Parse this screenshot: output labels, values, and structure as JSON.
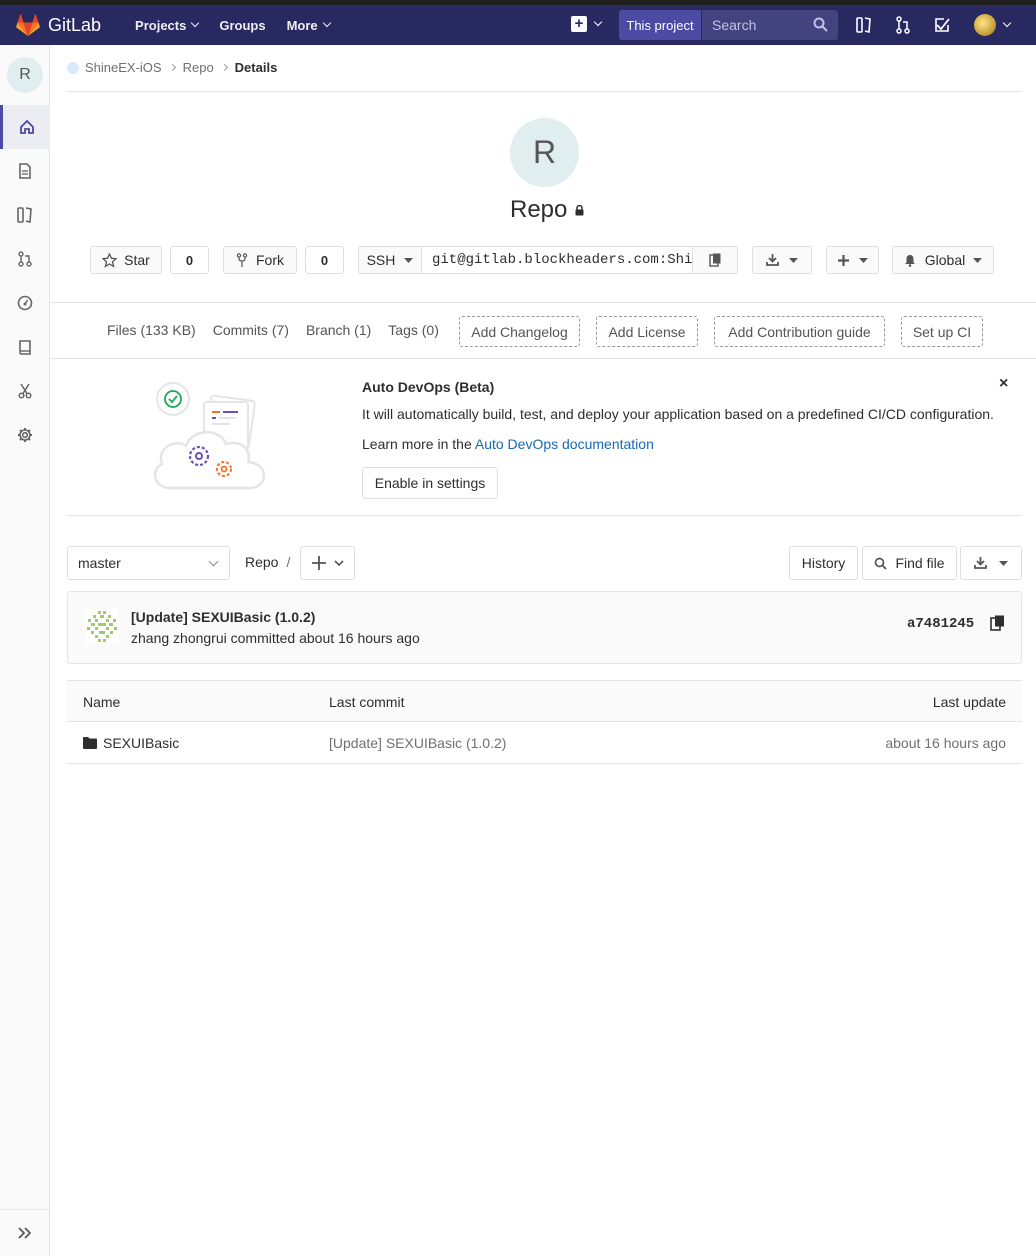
{
  "navbar": {
    "brand": "GitLab",
    "links": [
      "Projects",
      "Groups",
      "More"
    ],
    "this_project": "This project",
    "search_placeholder": "Search"
  },
  "sidebar": {
    "avatar_letter": "R"
  },
  "breadcrumb": {
    "group": "ShineEX-iOS",
    "project": "Repo",
    "current": "Details"
  },
  "project": {
    "avatar_letter": "R",
    "name": "Repo",
    "star_label": "Star",
    "star_count": "0",
    "fork_label": "Fork",
    "fork_count": "0",
    "clone_protocol": "SSH",
    "clone_url": "git@gitlab.blockheaders.com:ShineEX-iOS/Repo.git",
    "notification": "Global"
  },
  "stats": {
    "files": "Files (133 KB)",
    "commits": "Commits (7)",
    "branch": "Branch (1)",
    "tags": "Tags (0)",
    "add_changelog": "Add Changelog",
    "add_license": "Add License",
    "add_contribution": "Add Contribution guide",
    "setup_ci": "Set up CI"
  },
  "devops": {
    "title": "Auto DevOps (Beta)",
    "text": "It will automatically build, test, and deploy your application based on a predefined CI/CD configuration.",
    "learn_prefix": "Learn more in the ",
    "learn_link": "Auto DevOps documentation",
    "enable_button": "Enable in settings",
    "close": "×"
  },
  "tree": {
    "branch": "master",
    "path_root": "Repo",
    "path_sep": "/",
    "history": "History",
    "find_file": "Find file"
  },
  "last_commit": {
    "title": "[Update] SEXUIBasic (1.0.2)",
    "meta": "zhang zhongrui committed about 16 hours ago",
    "sha": "a7481245"
  },
  "table": {
    "headers": [
      "Name",
      "Last commit",
      "Last update"
    ],
    "rows": [
      {
        "name": "SEXUIBasic",
        "commit": "[Update] SEXUIBasic (1.0.2)",
        "updated": "about 16 hours ago"
      }
    ]
  },
  "colors": {
    "navbar": "#292961",
    "link": "#1b69b6"
  }
}
